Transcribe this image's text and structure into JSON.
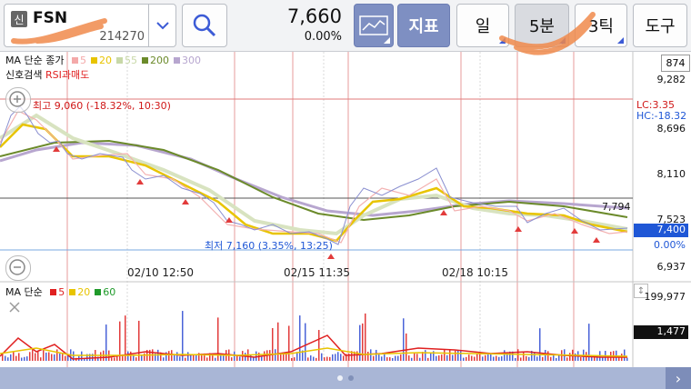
{
  "stock": {
    "badge": "신",
    "name": "FSN",
    "code": "214270",
    "price": "7,660",
    "change_pct": "0.00%"
  },
  "toolbar": {
    "indicator_label": "지표",
    "period_day": "일",
    "period_5min": "5분",
    "period_3tick": "3틱",
    "tools": "도구"
  },
  "legend": {
    "ma_title": "MA 단순 종가",
    "ma_items": [
      {
        "label": "5",
        "color": "#f4a9a9"
      },
      {
        "label": "20",
        "color": "#e8c400"
      },
      {
        "label": "55",
        "color": "#c8d8a8"
      },
      {
        "label": "200",
        "color": "#6b8a2a"
      },
      {
        "label": "300",
        "color": "#b7a6cf"
      }
    ],
    "signal_title": "신호검색",
    "signal_rsi": "RSI과매도"
  },
  "annotations": {
    "high": "최고 9,060 (-18.32%, 10:30)",
    "low": "최저 7,160 (3.35%, 13:25)",
    "lc": "LC:3.35",
    "hc": "HC:-18.32",
    "hline_value": "7,794"
  },
  "price_axis": {
    "top_box": "874",
    "ticks": [
      "9,282",
      "8,696",
      "8,110",
      "7,523",
      "6,937"
    ],
    "current": "7,400",
    "current_pct": "0.00%"
  },
  "time_axis": [
    "02/10 12:50",
    "02/15 11:35",
    "02/18 10:15"
  ],
  "volume": {
    "title": "MA 단순",
    "items": [
      {
        "label": "5",
        "color": "#e02020"
      },
      {
        "label": "20",
        "color": "#e8c400"
      },
      {
        "label": "60",
        "color": "#1f9a2a"
      }
    ],
    "axis_top": "199,977",
    "current": "1,477"
  },
  "colors": {
    "accent_blue": "#3c5bd6",
    "red_vline": "#e07070",
    "price_up": "#e02020",
    "price_down": "#1f57d6",
    "bottom_bar": "#a9b6d6"
  },
  "chart_data": {
    "type": "line",
    "x": [
      "02/10 12:50",
      "02/15 11:35",
      "02/18 10:15"
    ],
    "ylim": [
      6937,
      9282
    ],
    "series": [
      {
        "name": "5",
        "values": [
          8696,
          8900,
          8500,
          8400,
          8100,
          7700,
          7450,
          7350,
          7250,
          7900,
          7950,
          8000,
          7850,
          7700,
          7600,
          7550,
          7450
        ]
      },
      {
        "name": "20",
        "values": [
          8600,
          8800,
          8550,
          8450,
          8150,
          7800,
          7500,
          7400,
          7300,
          7800,
          7900,
          7850,
          7800,
          7750,
          7650,
          7600,
          7500
        ]
      },
      {
        "name": "200",
        "values": [
          8500,
          8550,
          8500,
          8450,
          8300,
          8100,
          7850,
          7650,
          7550,
          7600,
          7700,
          7750,
          7780,
          7760,
          7740,
          7700,
          7650
        ]
      },
      {
        "name": "300",
        "values": [
          8300,
          8400,
          8420,
          8400,
          8300,
          8200,
          8000,
          7850,
          7750,
          7700,
          7730,
          7760,
          7770,
          7760,
          7750,
          7720,
          7700
        ]
      }
    ]
  }
}
